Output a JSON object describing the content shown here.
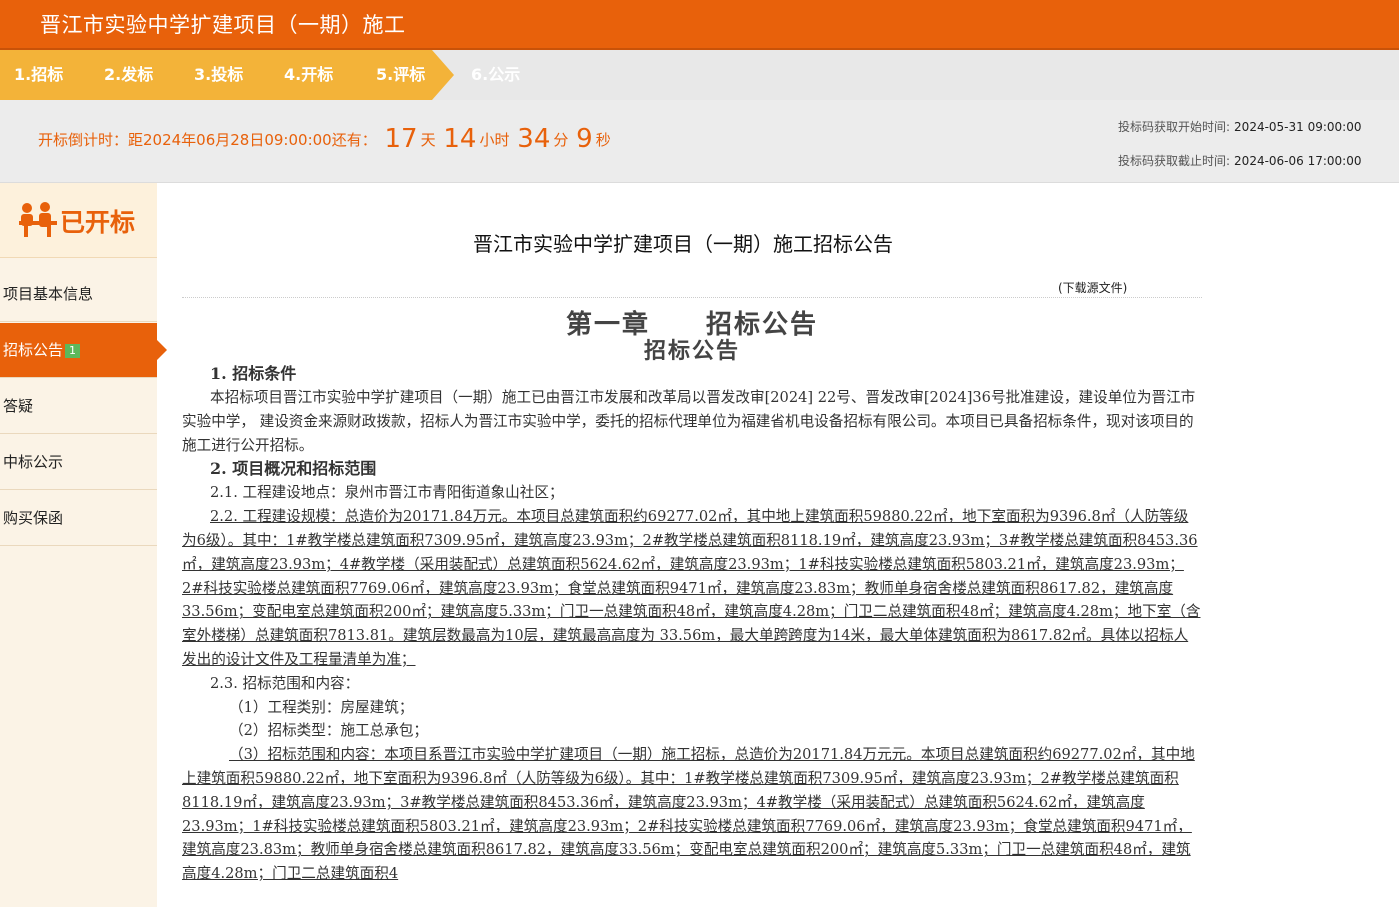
{
  "header": {
    "title": "晋江市实验中学扩建项目（一期）施工"
  },
  "steps": [
    {
      "label": "1.招标",
      "state": "done"
    },
    {
      "label": "2.发标",
      "state": "done"
    },
    {
      "label": "3.投标",
      "state": "done"
    },
    {
      "label": "4.开标",
      "state": "done"
    },
    {
      "label": "5.评标",
      "state": "current"
    },
    {
      "label": "6.公示",
      "state": "future"
    }
  ],
  "countdown": {
    "prefix": "开标倒计时：距2024年06月28日09:00:00还有：",
    "days": "17",
    "days_unit": "天",
    "hours": "14",
    "hours_unit": "小时",
    "minutes": "34",
    "minutes_unit": "分",
    "seconds": "9",
    "seconds_unit": "秒",
    "start_label": "投标码获取开始时间:",
    "start_value": "2024-05-31 09:00:00",
    "end_label": "投标码获取截止时间:",
    "end_value": "2024-06-06 17:00:00"
  },
  "sidebar": {
    "status": "已开标",
    "items": [
      {
        "label": "项目基本信息",
        "badge": ""
      },
      {
        "label": "招标公告",
        "badge": "1"
      },
      {
        "label": "答疑",
        "badge": ""
      },
      {
        "label": "中标公示",
        "badge": ""
      },
      {
        "label": "购买保函",
        "badge": ""
      }
    ]
  },
  "document": {
    "title": "晋江市实验中学扩建项目（一期）施工招标公告",
    "download": "(下载源文件)",
    "chapter": "第一章　　招标公告",
    "chapter_sub": "招标公告",
    "s1_heading": "1.  招标条件",
    "s1_text": "本招标项目晋江市实验中学扩建项目（一期）施工已由晋江市发展和改革局以晋发改审[2024] 22号、晋发改审[2024]36号批准建设，建设单位为晋江市实验中学，  建设资金来源财政拨款，招标人为晋江市实验中学，委托的招标代理单位为福建省机电设备招标有限公司。本项目已具备招标条件，现对该项目的施工进行公开招标。",
    "s2_heading": "2.  项目概况和招标范围",
    "s2_1": "2.1. 工程建设地点：泉州市晋江市青阳街道象山社区；",
    "s2_2": "2.2. 工程建设规模：总造价为20171.84万元。本项目总建筑面积约69277.02㎡，其中地上建筑面积59880.22㎡，地下室面积为9396.8㎡（人防等级为6级）。其中：1#教学楼总建筑面积7309.95㎡，建筑高度23.93m；2#教学楼总建筑面积8118.19㎡，建筑高度23.93m；3#教学楼总建筑面积8453.36㎡，建筑高度23.93m；4#教学楼（采用装配式）总建筑面积5624.62㎡，建筑高度23.93m；1#科技实验楼总建筑面积5803.21㎡，建筑高度23.93m；2#科技实验楼总建筑面积7769.06㎡，建筑高度23.93m；食堂总建筑面积9471㎡，建筑高度23.83m；教师单身宿舍楼总建筑面积8617.82，建筑高度33.56m；变配电室总建筑面积200㎡；建筑高度5.33m；门卫一总建筑面积48㎡，建筑高度4.28m；门卫二总建筑面积48㎡；建筑高度4.28m；地下室（含室外楼梯）总建筑面积7813.81。建筑层数最高为10层，建筑最高高度为 33.56m，最大单跨跨度为14米，最大单体建筑面积为8617.82㎡。具体以招标人发出的设计文件及工程量清单为准；",
    "s2_3": "2.3. 招标范围和内容：",
    "s2_3_1": "（1）工程类别：房屋建筑；",
    "s2_3_2": "（2）招标类型：施工总承包；",
    "s2_3_3": "（3）招标范围和内容：本项目系晋江市实验中学扩建项目（一期）施工招标，总造价为20171.84万元元。本项目总建筑面积约69277.02㎡，其中地上建筑面积59880.22㎡，地下室面积为9396.8㎡（人防等级为6级）。其中：1#教学楼总建筑面积7309.95㎡，建筑高度23.93m；2#教学楼总建筑面积8118.19㎡，建筑高度23.93m；3#教学楼总建筑面积8453.36㎡，建筑高度23.93m；4#教学楼（采用装配式）总建筑面积5624.62㎡，建筑高度23.93m；1#科技实验楼总建筑面积5803.21㎡，建筑高度23.93m；2#科技实验楼总建筑面积7769.06㎡，建筑高度23.93m；食堂总建筑面积9471㎡，建筑高度23.83m；教师单身宿舍楼总建筑面积8617.82，建筑高度33.56m；变配电室总建筑面积200㎡；建筑高度5.33m；门卫一总建筑面积48㎡，建筑高度4.28m；门卫二总建筑面积4"
  },
  "colors": {
    "accent": "#e8610b",
    "steps_done": "#f3b339",
    "badge": "#5cb85c"
  }
}
